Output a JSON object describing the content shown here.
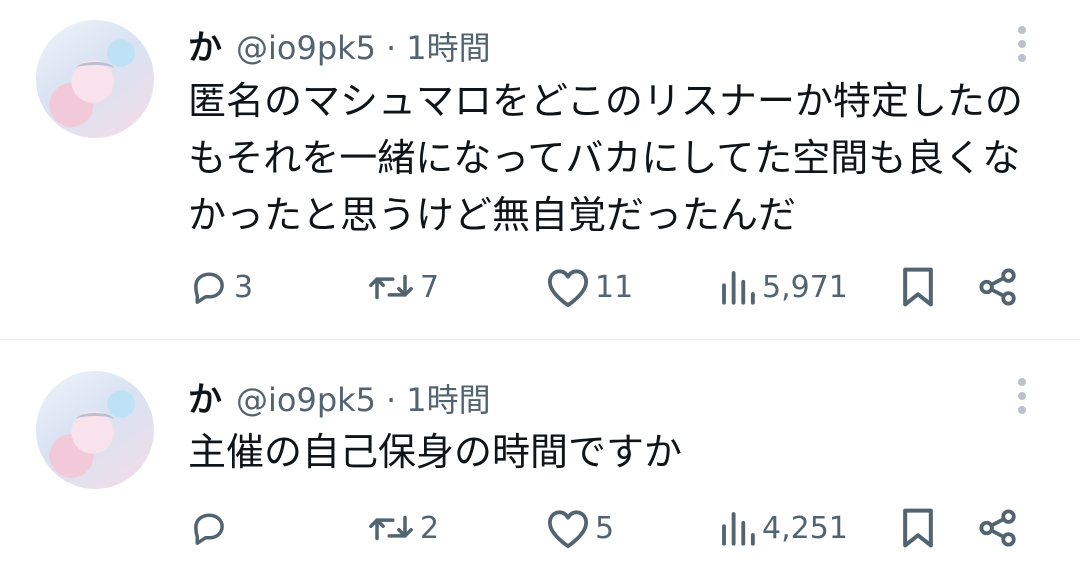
{
  "tweets": [
    {
      "name": "か",
      "handle": "@io9pk5",
      "separator": "·",
      "time": "1時間",
      "text": "匿名のマシュマロをどこのリスナーか特定したのもそれを一緒になってバカにしてた空間も良くなかったと思うけど無自覚だったんだ",
      "replies": "3",
      "retweets": "7",
      "likes": "11",
      "views": "5,971"
    },
    {
      "name": "か",
      "handle": "@io9pk5",
      "separator": "·",
      "time": "1時間",
      "text": "主催の自己保身の時間ですか",
      "replies": "",
      "retweets": "2",
      "likes": "5",
      "views": "4,251"
    }
  ],
  "icons": {
    "reply": "reply-icon",
    "retweet": "retweet-icon",
    "like": "heart-icon",
    "views": "views-icon",
    "bookmark": "bookmark-icon",
    "share": "share-icon",
    "more": "more-vertical-icon"
  },
  "colors": {
    "text": "#0f1419",
    "secondary": "#536471",
    "divider": "#e6e9eb",
    "background": "#ffffff"
  }
}
